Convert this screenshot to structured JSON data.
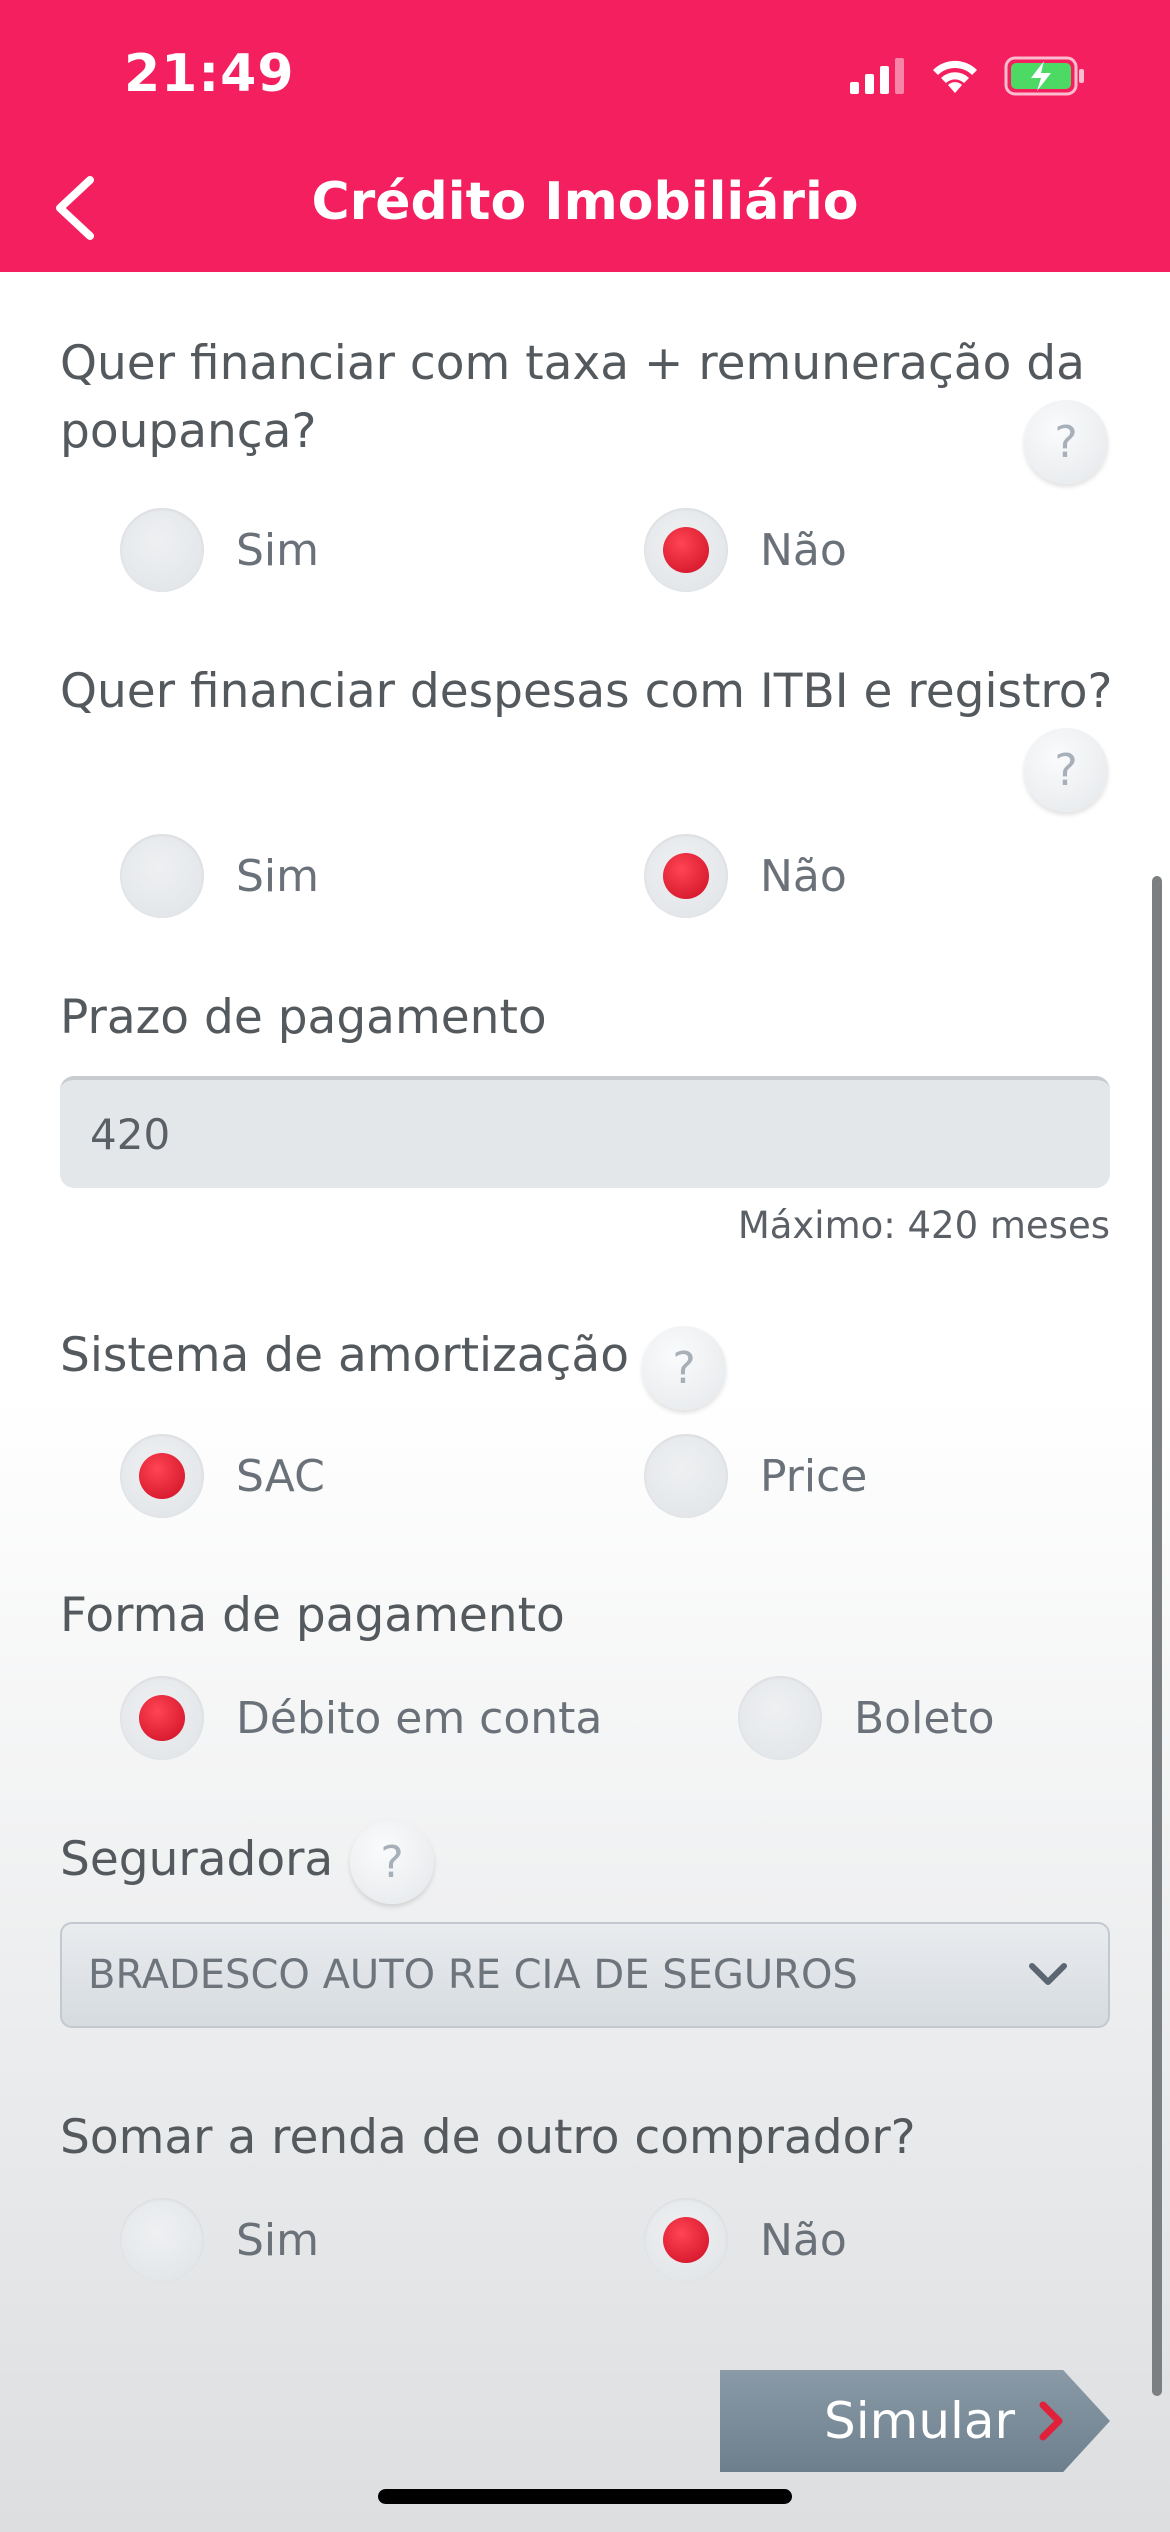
{
  "status_bar": {
    "time": "21:49"
  },
  "header": {
    "title": "Crédito Imobiliário"
  },
  "questions": {
    "poupanca": {
      "label_line1": "Quer financiar com taxa + remuneração da",
      "label_line2": "poupança?",
      "help": "?",
      "options": [
        "Sim",
        "Não"
      ],
      "selected": "Não"
    },
    "itbi": {
      "label": "Quer financiar despesas com ITBI e registro?",
      "help": "?",
      "options": [
        "Sim",
        "Não"
      ],
      "selected": "Não"
    },
    "prazo": {
      "label": "Prazo de pagamento",
      "value": "420",
      "hint": "Máximo: 420 meses"
    },
    "amortizacao": {
      "label": "Sistema de amortização",
      "help": "?",
      "options": [
        "SAC",
        "Price"
      ],
      "selected": "SAC"
    },
    "pagamento": {
      "label": "Forma de pagamento",
      "options": [
        "Débito em conta",
        "Boleto"
      ],
      "selected": "Débito em conta"
    },
    "seguradora": {
      "label": "Seguradora",
      "help": "?",
      "value": "BRADESCO AUTO RE CIA DE SEGUROS"
    },
    "somar_renda": {
      "label": "Somar a renda de outro comprador?",
      "options": [
        "Sim",
        "Não"
      ],
      "selected": "Não"
    }
  },
  "actions": {
    "simulate_label": "Simular"
  },
  "colors": {
    "brand": "#f31f5f",
    "radio_selected": "#d8142a",
    "button": "#7a8b98"
  }
}
